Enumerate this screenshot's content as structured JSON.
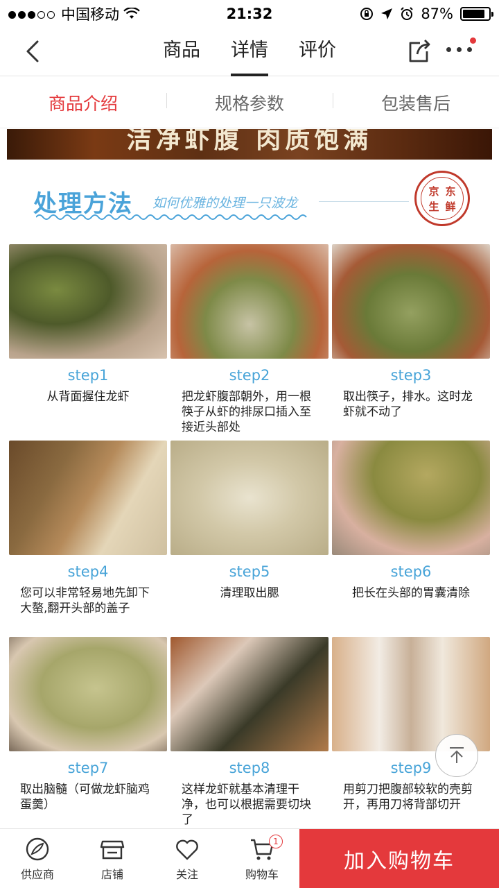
{
  "status_bar": {
    "carrier": "中国移动",
    "time": "21:32",
    "battery": "87%",
    "battery_level": 0.87
  },
  "nav": {
    "tabs": [
      "商品",
      "详情",
      "评价"
    ],
    "active_tab": "详情"
  },
  "sub_tabs": {
    "items": [
      "商品介绍",
      "规格参数",
      "包装售后"
    ],
    "active": "商品介绍"
  },
  "banner": {
    "text": "洁净虾腹  肉质饱满"
  },
  "section": {
    "title": "处理方法",
    "subtitle": "如何优雅的处理一只波龙",
    "seal_chars": [
      "京",
      "东",
      "生",
      "鲜"
    ]
  },
  "steps": [
    {
      "label": "step1",
      "desc": "从背面握住龙虾"
    },
    {
      "label": "step2",
      "desc": "把龙虾腹部朝外，用一根筷子从虾的排尿口插入至接近头部处"
    },
    {
      "label": "step3",
      "desc": "取出筷子，排水。这时龙虾就不动了"
    },
    {
      "label": "step4",
      "desc": "您可以非常轻易地先卸下大螯,翻开头部的盖子"
    },
    {
      "label": "step5",
      "desc": "清理取出腮"
    },
    {
      "label": "step6",
      "desc": "把长在头部的胃囊清除"
    },
    {
      "label": "step7",
      "desc": "取出脑髓（可做龙虾脑鸡蛋羹）"
    },
    {
      "label": "step8",
      "desc": "这样龙虾就基本清理干净，也可以根据需要切块了"
    },
    {
      "label": "step9",
      "desc": "用剪刀把腹部较软的壳剪开，再用刀将背部切开"
    }
  ],
  "bottom_bar": {
    "supplier": "供应商",
    "shop": "店铺",
    "follow": "关注",
    "cart": "购物车",
    "cart_count": "1",
    "add_to_cart": "加入购物车"
  },
  "colors": {
    "accent": "#e4393c",
    "step_blue": "#48a4d8",
    "title_blue": "#4aa3d9"
  }
}
